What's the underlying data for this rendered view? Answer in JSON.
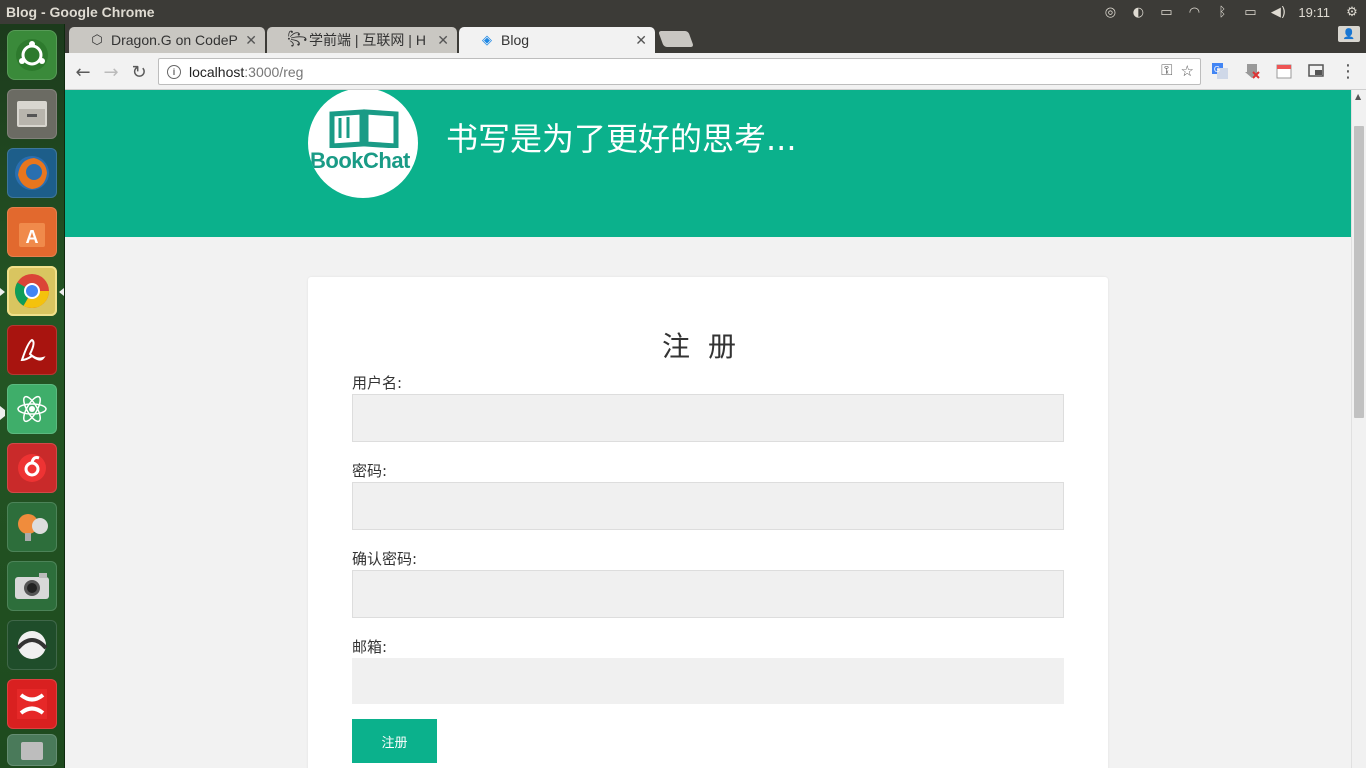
{
  "window": {
    "title": "Blog - Google Chrome"
  },
  "system_tray": {
    "clock": "19:11"
  },
  "tabs": [
    {
      "label": "Dragon.G on CodeP",
      "favicon": "codepen-icon"
    },
    {
      "label": "学前端 | 互联网 | H",
      "favicon": "site-icon"
    },
    {
      "label": "Blog",
      "favicon": "blog-icon",
      "active": true
    }
  ],
  "address_bar": {
    "host": "localhost",
    "path": ":3000/reg"
  },
  "site": {
    "logo_text": "BookChat",
    "slogan": "书写是为了更好的思考..."
  },
  "form": {
    "title": "注册",
    "fields": [
      {
        "label": "用户名:",
        "value": ""
      },
      {
        "label": "密码:",
        "value": ""
      },
      {
        "label": "确认密码:",
        "value": ""
      },
      {
        "label": "邮箱:",
        "value": ""
      }
    ],
    "submit_label": "注册"
  },
  "colors": {
    "brand": "#0bb18c",
    "page_bg": "#f2f2f2"
  }
}
